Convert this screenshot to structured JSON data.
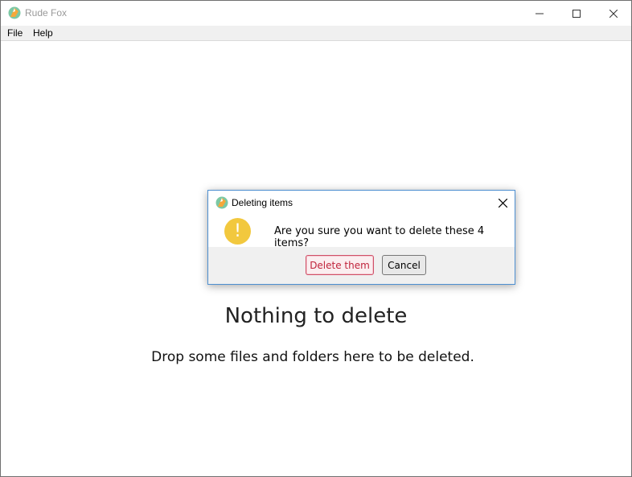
{
  "window": {
    "title": "Rude Fox",
    "controls": {
      "minimize": "minimize-icon",
      "maximize": "maximize-icon",
      "close": "close-icon"
    }
  },
  "menubar": {
    "items": [
      {
        "label": "File"
      },
      {
        "label": "Help"
      }
    ]
  },
  "empty_state": {
    "title": "Nothing to delete",
    "subtitle": "Drop some files and folders here to be deleted."
  },
  "dialog": {
    "title": "Deleting items",
    "icon": "warning-icon",
    "icon_glyph": "!",
    "message": "Are you sure you want to delete these 4 items?",
    "confirm_label": "Delete them",
    "cancel_label": "Cancel"
  },
  "colors": {
    "dialog_border": "#4d8fd1",
    "warning": "#f2c83e",
    "danger": "#c0243c",
    "fox_orange": "#f5a83a",
    "fox_bg_green": "#7cc8a4"
  }
}
